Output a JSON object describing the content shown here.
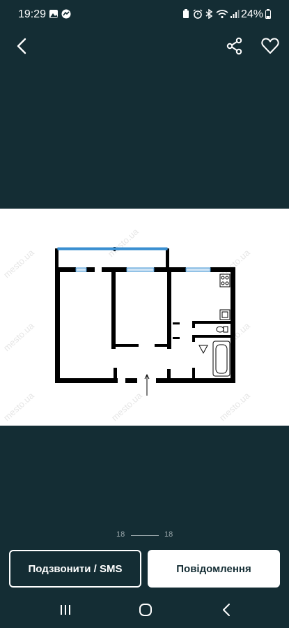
{
  "status_bar": {
    "time": "19:29",
    "battery": "24%",
    "left_icons": [
      "image-icon",
      "messenger-icon"
    ],
    "right_icons": [
      "battery-saver-icon",
      "alarm-icon",
      "bluetooth-icon",
      "wifi-icon",
      "signal-icon",
      "battery-icon"
    ]
  },
  "toolbar": {
    "back_icon": "chevron-left-icon",
    "share_icon": "share-icon",
    "favorite_icon": "heart-icon"
  },
  "gallery": {
    "image_alt": "floor-plan",
    "watermark": "mesto.ua",
    "current": "18",
    "total": "18"
  },
  "actions": {
    "call_label": "Подзвонити / SMS",
    "message_label": "Повідомлення"
  },
  "nav_bar": {
    "icons": [
      "recent-apps-icon",
      "home-icon",
      "back-icon"
    ]
  },
  "colors": {
    "background": "#142d34",
    "window_blue": "#3a8fd1"
  }
}
